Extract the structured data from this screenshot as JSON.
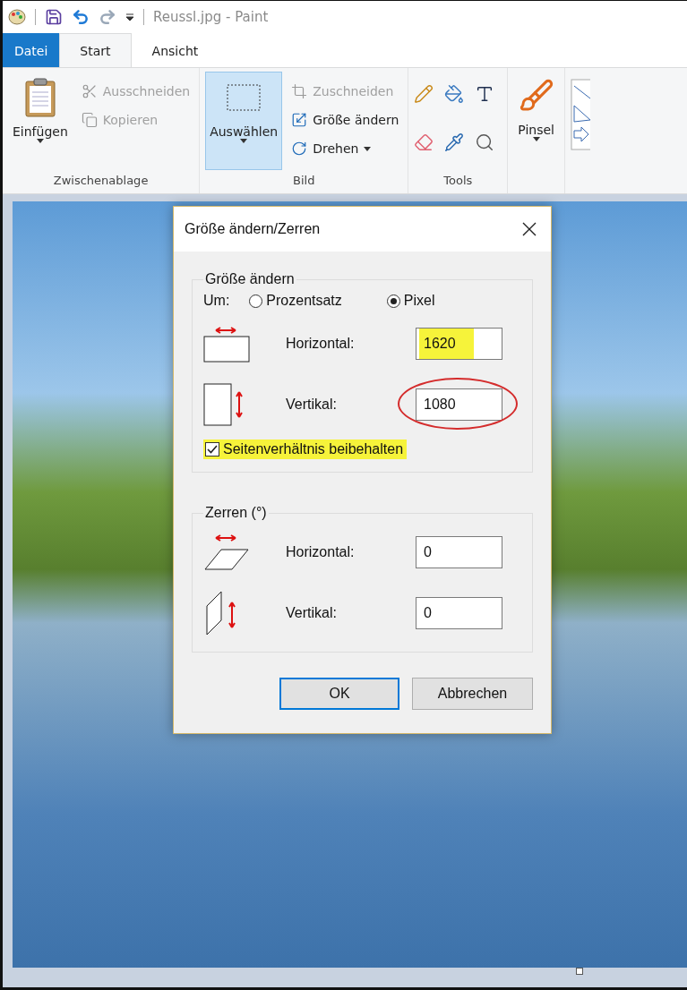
{
  "window": {
    "title": "Reussl.jpg - Paint"
  },
  "tabs": [
    {
      "label": "Datei",
      "kind": "file",
      "selected": false
    },
    {
      "label": "Start",
      "kind": "tab",
      "selected": true
    },
    {
      "label": "Ansicht",
      "kind": "tab",
      "selected": false
    }
  ],
  "ribbon": {
    "clipboard": {
      "label": "Zwischenablage",
      "paste": "Einfügen",
      "cut": {
        "label": "Ausschneiden",
        "disabled": true
      },
      "copy": {
        "label": "Kopieren",
        "disabled": true
      }
    },
    "image": {
      "label": "Bild",
      "select": {
        "label": "Auswählen",
        "selected": true
      },
      "crop": {
        "label": "Zuschneiden",
        "disabled": true
      },
      "resize": {
        "label": "Größe ändern",
        "disabled": false
      },
      "rotate": {
        "label": "Drehen",
        "disabled": false
      }
    },
    "tools": {
      "label": "Tools"
    },
    "brushes": {
      "label": "Pinsel"
    }
  },
  "dialog": {
    "title": "Größe ändern/Zerren",
    "resize": {
      "legend": "Größe ändern",
      "by_label": "Um:",
      "options": [
        {
          "label": "Prozentsatz",
          "selected": false
        },
        {
          "label": "Pixel",
          "selected": true
        }
      ],
      "fields": [
        {
          "label": "Horizontal:",
          "value": "1620",
          "highlighted": true,
          "circled": false
        },
        {
          "label": "Vertikal:",
          "value": "1080",
          "highlighted": false,
          "circled": true
        }
      ],
      "keep_ratio": {
        "label": "Seitenverhältnis beibehalten",
        "checked": true,
        "highlighted": true
      }
    },
    "skew": {
      "legend": "Zerren (°)",
      "fields": [
        {
          "label": "Horizontal:",
          "value": "0"
        },
        {
          "label": "Vertikal:",
          "value": "0"
        }
      ]
    },
    "buttons": [
      {
        "label": "OK",
        "default": true
      },
      {
        "label": "Abbrechen",
        "default": false
      }
    ]
  }
}
